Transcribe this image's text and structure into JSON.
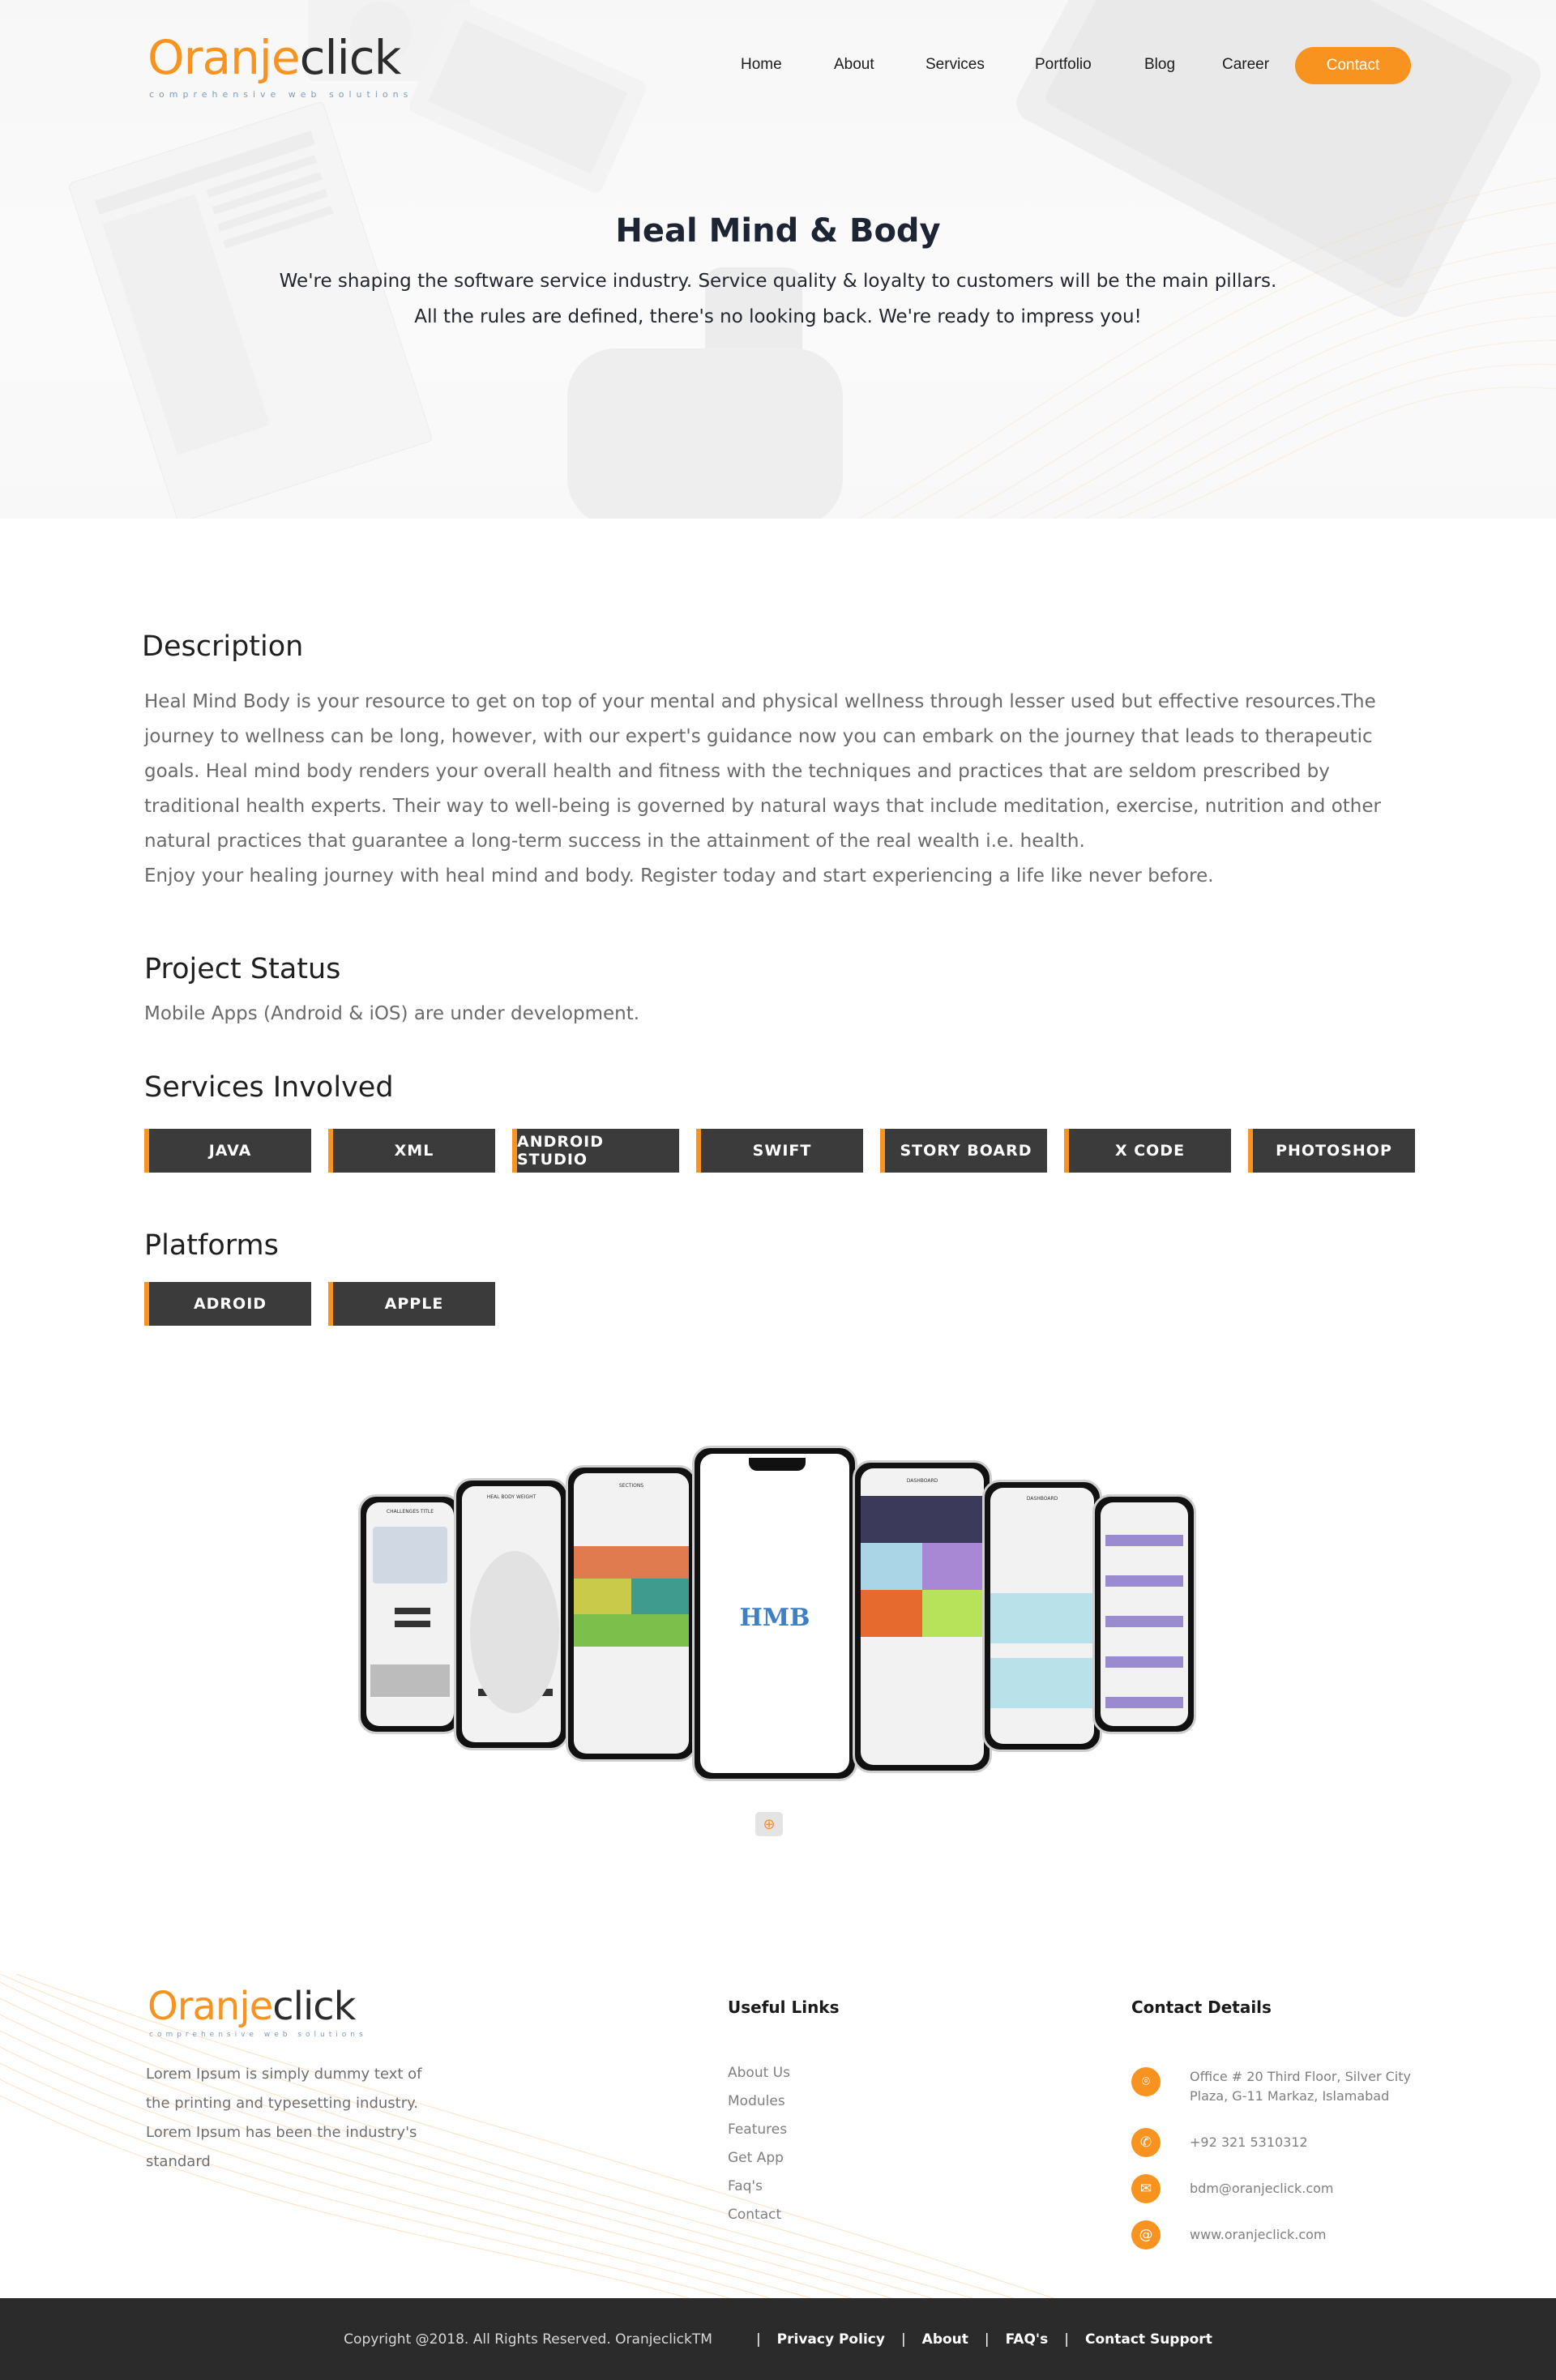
{
  "brand": {
    "name_part1": "Oranje",
    "name_part2": "click",
    "tagline": "comprehensive web solutions"
  },
  "nav": {
    "items": [
      "Home",
      "About",
      "Services",
      "Portfolio",
      "Blog",
      "Career"
    ],
    "contact_label": "Contact"
  },
  "hero": {
    "title": "Heal Mind & Body",
    "subtitle_line1": "We're shaping the software service industry. Service quality & loyalty to customers will be the main pillars.",
    "subtitle_line2": "All the rules are defined, there's no looking back. We're ready to impress you!"
  },
  "description": {
    "heading": "Description",
    "paragraph1": "Heal Mind Body is your resource to get on top of your mental and physical wellness through lesser used but effective resources.The journey to wellness can be long, however, with our expert's guidance now you can embark on the journey that leads to therapeutic goals. Heal mind body renders your overall health and fitness with the techniques and practices that are seldom prescribed by traditional health experts. Their way to well-being is governed by natural ways that include meditation, exercise, nutrition and other natural practices that guarantee a long-term success in the attainment of the real wealth i.e. health.",
    "paragraph2": "Enjoy your healing journey with heal mind and body. Register today and start experiencing a life like never before."
  },
  "project_status": {
    "heading": "Project Status",
    "text": "Mobile Apps (Android & iOS) are under development."
  },
  "services": {
    "heading": "Services Involved",
    "items": [
      "JAVA",
      "XML",
      "ANDROID STUDIO",
      "SWIFT",
      "STORY BOARD",
      "X CODE",
      "PHOTOSHOP"
    ]
  },
  "platforms": {
    "heading": "Platforms",
    "items": [
      "ADROID",
      "APPLE"
    ]
  },
  "mockup": {
    "center_logo": "HMB",
    "screens": [
      "CHALLENGES TITLE",
      "HEAL BODY WEIGHT",
      "SECTIONS",
      "",
      "DASHBOARD",
      "DASHBOARD",
      ""
    ],
    "zoom_icon": "zoom-in-icon"
  },
  "footer": {
    "about_text": "Lorem Ipsum is simply dummy text of the printing and typesetting industry. Lorem Ipsum has been the industry's standard",
    "links_heading": "Useful Links",
    "links": [
      "About Us",
      "Modules",
      "Features",
      "Get App",
      "Faq's",
      "Contact"
    ],
    "contact_heading": "Contact Details",
    "address": "Office # 20 Third Floor, Silver City Plaza, G-11 Markaz, Islamabad",
    "phone": "+92 321 5310312",
    "email": "bdm@oranjeclick.com",
    "website": "www.oranjeclick.com",
    "copyright": "Copyright @2018. All Rights Reserved. OranjeclickTM",
    "bottom_links": [
      "Privacy Policy",
      "About",
      "FAQ's",
      "Contact Support"
    ]
  },
  "colors": {
    "accent": "#f7931e",
    "chip_bg": "#3b3b3b",
    "footer_bar": "#2b2b2b"
  }
}
